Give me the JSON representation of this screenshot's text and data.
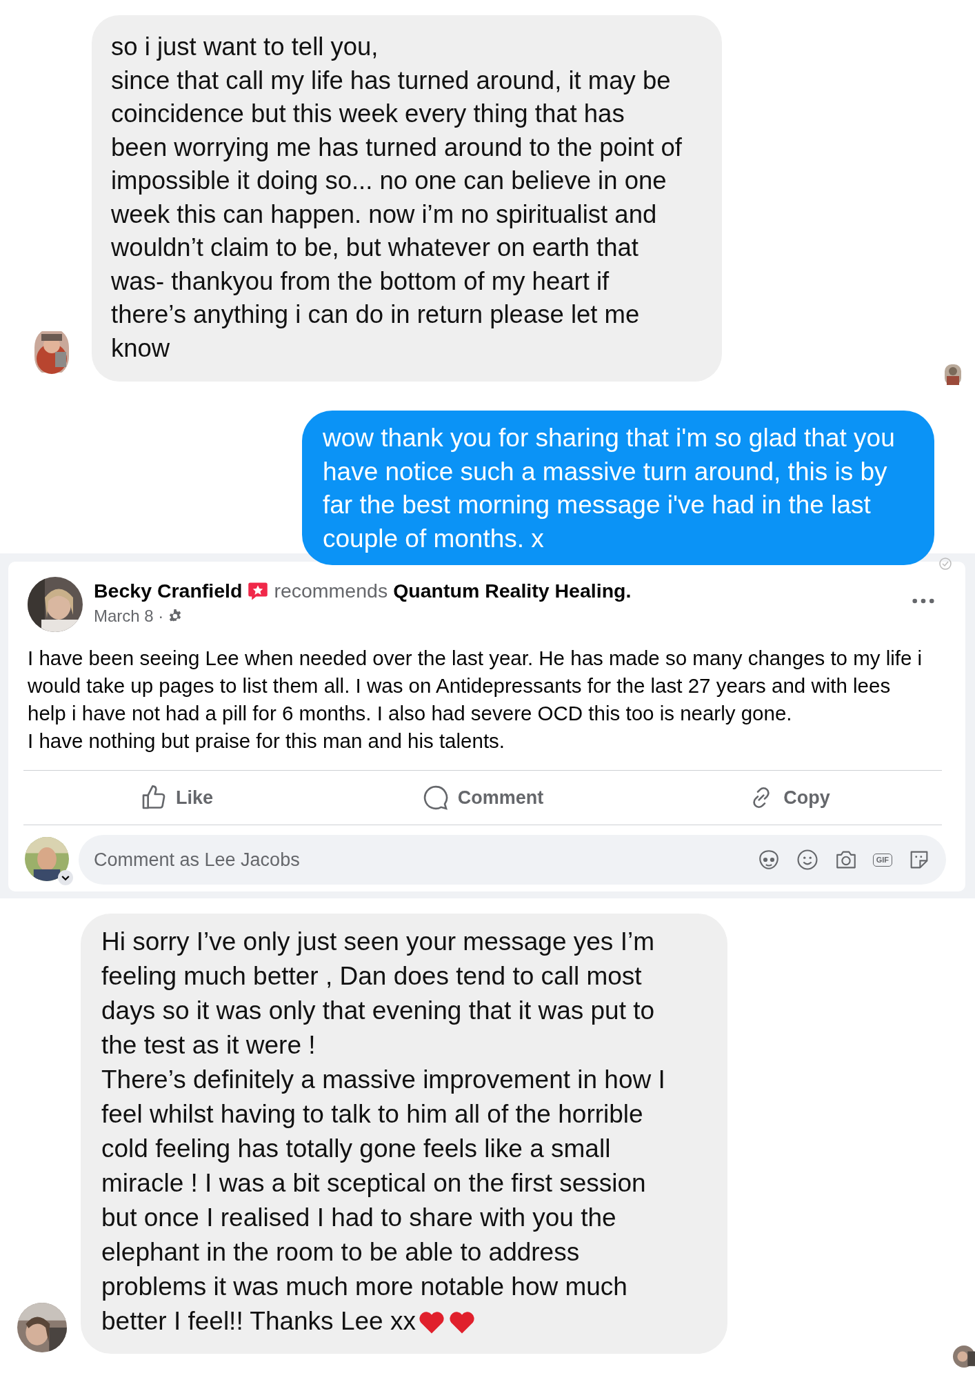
{
  "chat_1": {
    "received": {
      "lines": [
        "so i just want to tell you,",
        "since that call my life has turned around, it may be",
        "coincidence but this week every thing that has",
        "been worrying me has turned around to the point of",
        "impossible it doing so... no one can believe in one",
        "week this can happen. now i’m no spiritualist and",
        "wouldn’t claim to be, but whatever on earth that",
        "was- thankyou from the bottom of my heart if",
        "there’s anything i can do in return please let me",
        "know"
      ]
    },
    "sent": {
      "lines": [
        "wow thank you for sharing that i'm so glad that you",
        "have notice such a massive turn around, this is by",
        "far the best morning message i've had in the last",
        "couple of months. x"
      ]
    }
  },
  "post": {
    "author": "Becky Cranfield",
    "action": "recommends",
    "page": "Quantum Reality Healing.",
    "date": "March 8 ·",
    "body": [
      "I have been seeing Lee when needed over the last year. He has made so many changes to my life i",
      "would take up pages to list them all. I was on Antidepressants for the last 27 years and with lees",
      "help i have not had a pill for 6 months. I also had severe OCD this too is nearly gone.",
      "I have nothing but praise for this man and his talents."
    ],
    "actions": [
      {
        "kind": "like",
        "label": "Like"
      },
      {
        "kind": "comment",
        "label": "Comment"
      },
      {
        "kind": "copy",
        "label": "Copy"
      }
    ],
    "comment_field": {
      "placeholder": "Comment as Lee Jacobs",
      "gif_label": "GIF"
    }
  },
  "chat_2": {
    "received": {
      "lines": [
        "Hi sorry I’ve only just seen your message yes I’m",
        "feeling much better , Dan does tend to call most",
        "days so it was only that evening that it was put to",
        "the test as it were !",
        "There’s definitely a massive improvement in how I",
        "feel whilst having to talk to him all of the horrible",
        "cold feeling has totally gone feels like a small",
        "miracle ! I was a bit sceptical on the first session",
        "but once I realised I had to share with you the",
        "elephant in the room to be able to address",
        "problems it was much more notable how much",
        "better I feel!! Thanks Lee xx"
      ]
    }
  }
}
